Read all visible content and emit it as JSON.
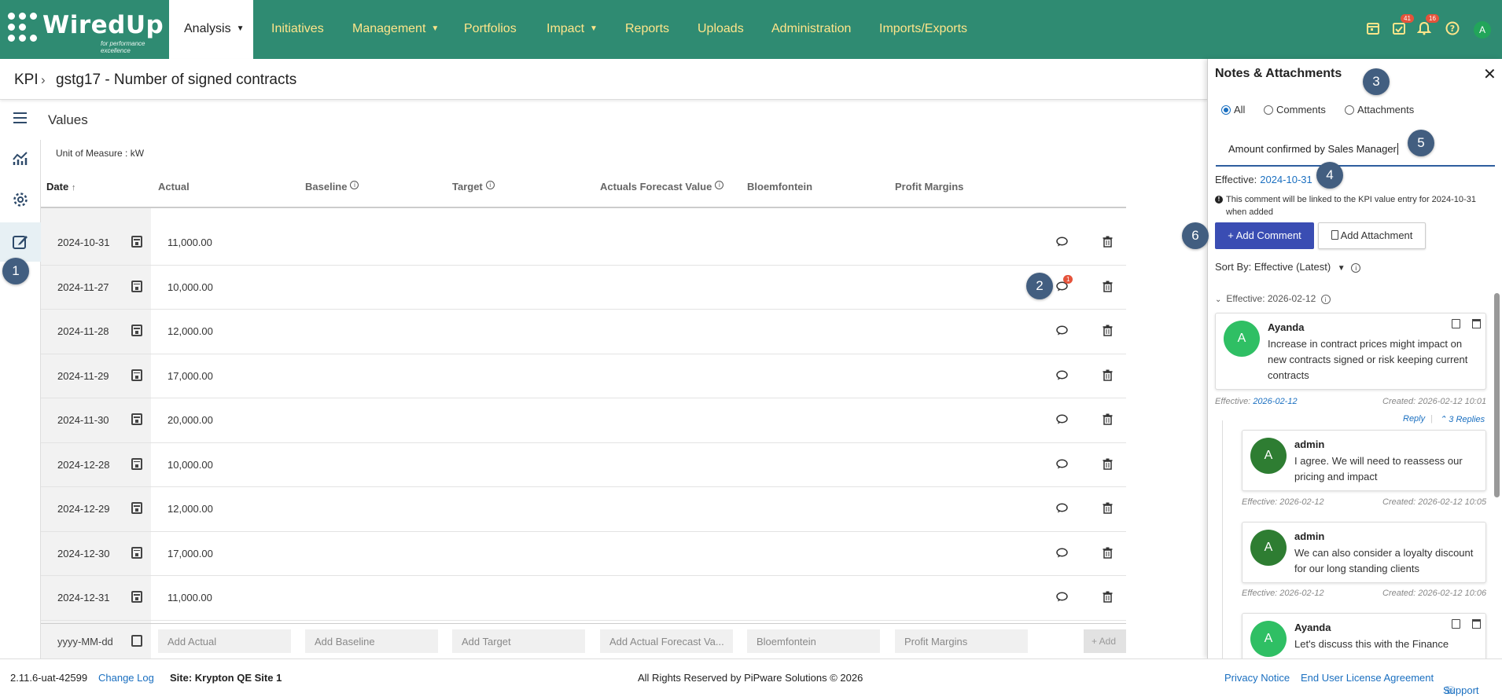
{
  "nav": {
    "brand": "WiredUp",
    "tagline": "for performance excellence",
    "tabs": [
      "Analysis",
      "Initiatives",
      "Management",
      "Portfolios",
      "Impact",
      "Reports",
      "Uploads",
      "Administration",
      "Imports/Exports"
    ],
    "badges": {
      "tasks": "41",
      "notifications": "16"
    },
    "user_initial": "A"
  },
  "title": {
    "crumb": "KPI",
    "name": "gstg17 - Number of signed contracts"
  },
  "values_label": "Values",
  "unit_of_measure": "Unit of Measure : kW",
  "table": {
    "headers": [
      "Date",
      "Actual",
      "Baseline",
      "Target",
      "Actuals Forecast Value",
      "Bloemfontein",
      "Profit Margins"
    ],
    "sort_arrow": "↑",
    "rows": [
      {
        "date": "2024-10-31",
        "actual": "11,000.00"
      },
      {
        "date": "2024-11-27",
        "actual": "10,000.00",
        "comments": "1"
      },
      {
        "date": "2024-11-28",
        "actual": "12,000.00"
      },
      {
        "date": "2024-11-29",
        "actual": "17,000.00"
      },
      {
        "date": "2024-11-30",
        "actual": "20,000.00"
      },
      {
        "date": "2024-12-28",
        "actual": "10,000.00"
      },
      {
        "date": "2024-12-29",
        "actual": "12,000.00"
      },
      {
        "date": "2024-12-30",
        "actual": "17,000.00"
      },
      {
        "date": "2024-12-31",
        "actual": "11,000.00"
      }
    ],
    "new_row": {
      "date_placeholder": "yyyy-MM-dd",
      "actual": "Add Actual",
      "baseline": "Add Baseline",
      "target": "Add Target",
      "forecast": "Add Actual Forecast Va...",
      "bloemfontein": "Bloemfontein",
      "profit": "Profit Margins",
      "add": "+ Add"
    }
  },
  "markers": [
    "1",
    "2",
    "3",
    "4",
    "5",
    "6"
  ],
  "panel": {
    "title": "Notes & Attachments",
    "close": "✕",
    "filters": [
      "All",
      "Comments",
      "Attachments"
    ],
    "comment_value": "Amount confirmed by Sales Manager",
    "effective_label": "Effective:",
    "effective_date": "2024-10-31",
    "note": "This comment will be linked to the KPI value entry for 2024-10-31 when added",
    "add_comment": "+ Add Comment",
    "add_attachment": "Add Attachment",
    "sort_by": "Sort By: Effective (Latest)",
    "group": "Effective: 2026-02-12",
    "comments": [
      {
        "initial": "A",
        "user": "Ayanda",
        "text": "Increase in contract prices might impact on new contracts signed or risk keeping current contracts",
        "effective_label": "Effective:",
        "effective": "2026-02-12",
        "created": "Created: 2026-02-12 10:01",
        "reply": "Reply",
        "replies": "3 Replies"
      },
      {
        "initial": "A",
        "user": "admin",
        "text": "I agree. We will need to reassess our pricing and impact",
        "effective": "Effective: 2026-02-12",
        "created": "Created: 2026-02-12 10:05"
      },
      {
        "initial": "A",
        "user": "admin",
        "text": "We can also consider a loyalty discount for our long standing clients",
        "effective": "Effective: 2026-02-12",
        "created": "Created: 2026-02-12 10:06"
      },
      {
        "initial": "A",
        "user": "Ayanda",
        "text": "Let's discuss this with the Finance"
      }
    ]
  },
  "footer": {
    "version": "2.11.6-uat-42599",
    "changelog": "Change Log",
    "site": "Site: Krypton QE Site 1",
    "rights": "All Rights Reserved by PiPware Solutions © 2026",
    "privacy": "Privacy Notice",
    "eula": "End User License Agreement",
    "support": "Support"
  },
  "colors": {
    "nav_bg": "#2f8b72",
    "nav_text": "#ffe58a",
    "accent": "#3a4db3",
    "link": "#1a6fc0",
    "avatar_green": "#22a55a",
    "avatar_dark": "#2e7d32",
    "marker": "#425e80"
  }
}
